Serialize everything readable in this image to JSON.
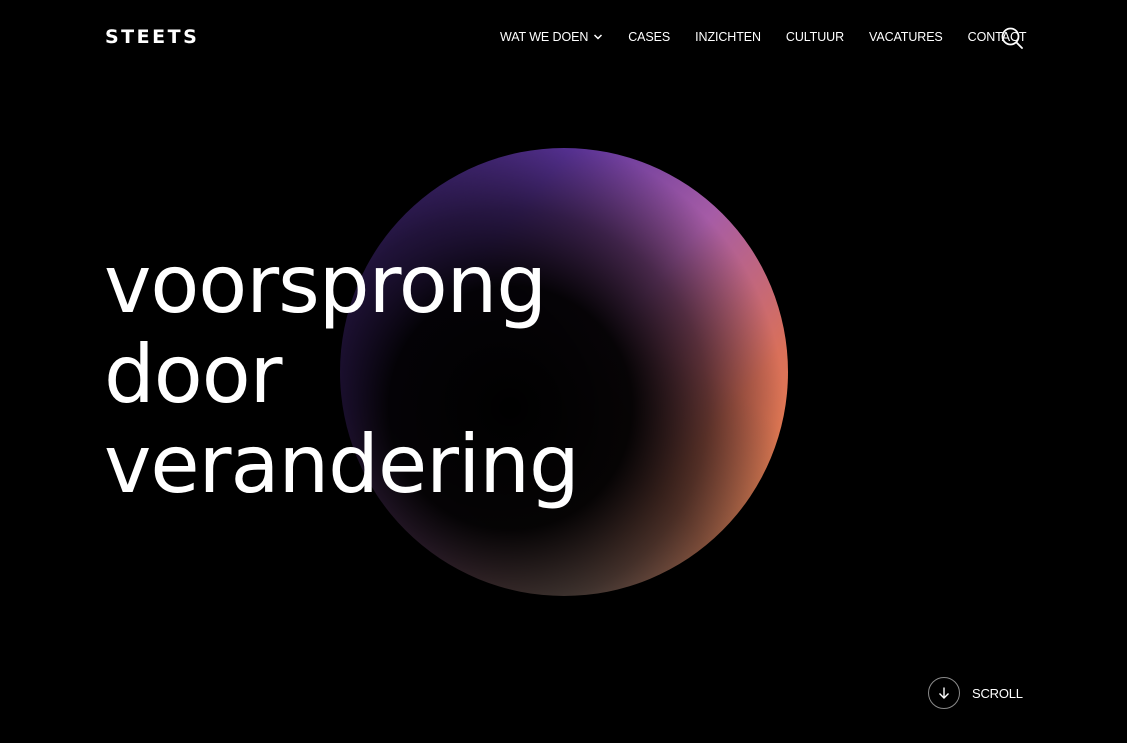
{
  "header": {
    "logo_text": "STEETS",
    "nav": [
      {
        "label": "WAT WE DOEN",
        "has_dropdown": true
      },
      {
        "label": "CASES"
      },
      {
        "label": "INZICHTEN"
      },
      {
        "label": "CULTUUR"
      },
      {
        "label": "VACATURES"
      },
      {
        "label": "CONTACT"
      }
    ],
    "search_icon": "search-icon"
  },
  "hero": {
    "lines": [
      "voorsprong",
      "door",
      "verandering"
    ]
  },
  "scroll": {
    "label": "SCROLL",
    "icon": "arrow-down-icon"
  },
  "colors": {
    "background": "#000000",
    "text": "#ffffff",
    "sphere_purple": "#5a3399",
    "sphere_orange": "#f08a45"
  }
}
